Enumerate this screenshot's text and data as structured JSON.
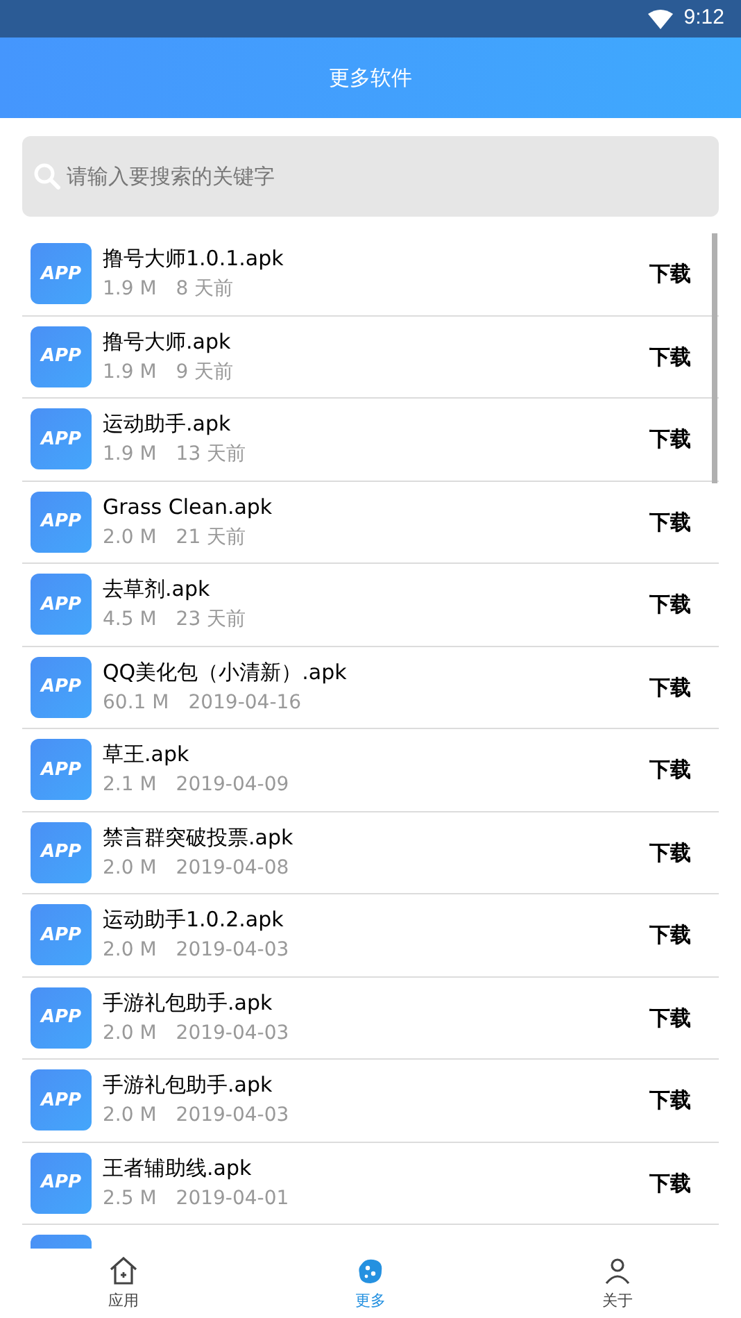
{
  "status_bar": {
    "time": "9:12"
  },
  "header": {
    "title": "更多软件"
  },
  "search": {
    "placeholder": "请输入要搜索的关键字"
  },
  "files": [
    {
      "icon": "APP",
      "name": "撸号大师1.0.1.apk",
      "size": "1.9 M",
      "date": "8 天前",
      "action": "下载"
    },
    {
      "icon": "APP",
      "name": "撸号大师.apk",
      "size": "1.9 M",
      "date": "9 天前",
      "action": "下载"
    },
    {
      "icon": "APP",
      "name": "运动助手.apk",
      "size": "1.9 M",
      "date": "13 天前",
      "action": "下载"
    },
    {
      "icon": "APP",
      "name": "Grass Clean.apk",
      "size": "2.0 M",
      "date": "21 天前",
      "action": "下载"
    },
    {
      "icon": "APP",
      "name": "去草剂.apk",
      "size": "4.5 M",
      "date": "23 天前",
      "action": "下载"
    },
    {
      "icon": "APP",
      "name": "QQ美化包（小清新）.apk",
      "size": "60.1 M",
      "date": "2019-04-16",
      "action": "下载"
    },
    {
      "icon": "APP",
      "name": "草王.apk",
      "size": "2.1 M",
      "date": "2019-04-09",
      "action": "下载"
    },
    {
      "icon": "APP",
      "name": "禁言群突破投票.apk",
      "size": "2.0 M",
      "date": "2019-04-08",
      "action": "下载"
    },
    {
      "icon": "APP",
      "name": "运动助手1.0.2.apk",
      "size": "2.0 M",
      "date": "2019-04-03",
      "action": "下载"
    },
    {
      "icon": "APP",
      "name": "手游礼包助手.apk",
      "size": "2.0 M",
      "date": "2019-04-03",
      "action": "下载"
    },
    {
      "icon": "APP",
      "name": "手游礼包助手.apk",
      "size": "2.0 M",
      "date": "2019-04-03",
      "action": "下载"
    },
    {
      "icon": "APP",
      "name": "王者辅助线.apk",
      "size": "2.5 M",
      "date": "2019-04-01",
      "action": "下载"
    }
  ],
  "bottom_nav": [
    {
      "label": "应用",
      "selected": false,
      "kind": "house"
    },
    {
      "label": "更多",
      "selected": true,
      "kind": "blob"
    },
    {
      "label": "关于",
      "selected": false,
      "kind": "person"
    }
  ]
}
